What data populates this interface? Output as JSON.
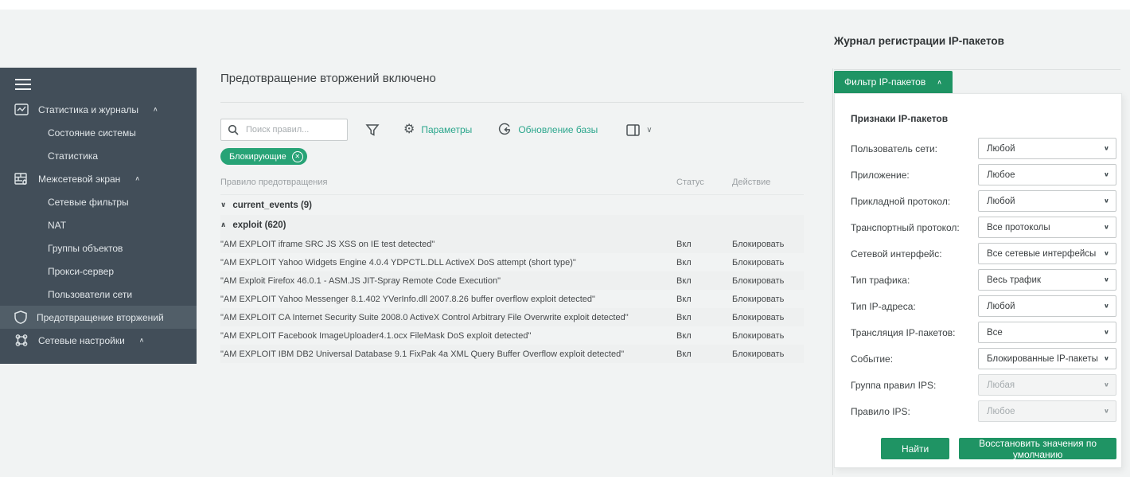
{
  "colors": {
    "page_bg": "#f1f3f3",
    "sidebar_bg": "#424e59",
    "sidebar_selected_bg": "#515e68",
    "accent_green": "#1f9464",
    "badge_green": "#27a376",
    "link_teal": "#2ba68c"
  },
  "sidebar": {
    "items": [
      {
        "label": "Статистика и журналы",
        "icon": "stats-journal-icon"
      },
      {
        "label": "Состояние системы"
      },
      {
        "label": "Статистика"
      },
      {
        "label": "Межсетевой экран",
        "icon": "firewall-icon"
      },
      {
        "label": "Сетевые фильтры"
      },
      {
        "label": "NAT"
      },
      {
        "label": "Группы объектов"
      },
      {
        "label": "Прокси-сервер"
      },
      {
        "label": "Пользователи сети"
      },
      {
        "label": "Предотвращение вторжений",
        "icon": "shield-icon",
        "selected": true
      },
      {
        "label": "Сетевые настройки",
        "icon": "network-nodes-icon"
      }
    ]
  },
  "main": {
    "title": "Предотвращение вторжений включено",
    "toolbar": {
      "search_placeholder": "Поиск правил...",
      "params_label": "Параметры",
      "update_label": "Обновление базы"
    },
    "filter_chip": "Блокирующие",
    "table": {
      "columns": {
        "rule": "Правило предотвращения",
        "status": "Статус",
        "action": "Действие"
      },
      "group_collapsed": "current_events (9)",
      "group_expanded": "exploit (620)",
      "rows": [
        {
          "name": "\"AM EXPLOIT iframe SRC JS XSS on IE test detected\"",
          "status": "Вкл",
          "action": "Блокировать"
        },
        {
          "name": "\"AM EXPLOIT Yahoo Widgets Engine 4.0.4 YDPCTL.DLL ActiveX DoS attempt (short type)\"",
          "status": "Вкл",
          "action": "Блокировать"
        },
        {
          "name": "\"AM Exploit Firefox 46.0.1 - ASM.JS JIT-Spray Remote Code Execution\"",
          "status": "Вкл",
          "action": "Блокировать"
        },
        {
          "name": "\"AM EXPLOIT Yahoo Messenger 8.1.402 YVerInfo.dll 2007.8.26 buffer overflow exploit detected\"",
          "status": "Вкл",
          "action": "Блокировать"
        },
        {
          "name": "\"AM EXPLOIT CA Internet Security Suite 2008.0 ActiveX Control Arbitrary File Overwrite exploit detected\"",
          "status": "Вкл",
          "action": "Блокировать"
        },
        {
          "name": "\"AM EXPLOIT Facebook ImageUploader4.1.ocx FileMask DoS exploit detected\"",
          "status": "Вкл",
          "action": "Блокировать"
        },
        {
          "name": "\"AM EXPLOIT IBM DB2 Universal Database 9.1 FixPak 4a XML Query Buffer Overflow exploit detected\"",
          "status": "Вкл",
          "action": "Блокировать"
        }
      ]
    }
  },
  "right_panel": {
    "title": "Журнал регистрации IP-пакетов",
    "filter_tab": "Фильтр IP-пакетов",
    "section_title": "Признаки IP-пакетов",
    "fields": [
      {
        "label": "Пользователь сети:",
        "value": "Любой"
      },
      {
        "label": "Приложение:",
        "value": "Любое"
      },
      {
        "label": "Прикладной протокол:",
        "value": "Любой"
      },
      {
        "label": "Транспортный протокол:",
        "value": "Все протоколы"
      },
      {
        "label": "Сетевой интерфейс:",
        "value": "Все сетевые интерфейсы"
      },
      {
        "label": "Тип трафика:",
        "value": "Весь трафик"
      },
      {
        "label": "Тип IP-адреса:",
        "value": "Любой"
      },
      {
        "label": "Трансляция IP-пакетов:",
        "value": "Все"
      },
      {
        "label": "Событие:",
        "value": "Блокированные IP-пакеты"
      },
      {
        "label": "Группа правил IPS:",
        "value": "Любая",
        "disabled": true
      },
      {
        "label": "Правило IPS:",
        "value": "Любое",
        "disabled": true
      }
    ],
    "buttons": {
      "find": "Найти",
      "reset": "Восстановить значения по умолчанию"
    }
  }
}
